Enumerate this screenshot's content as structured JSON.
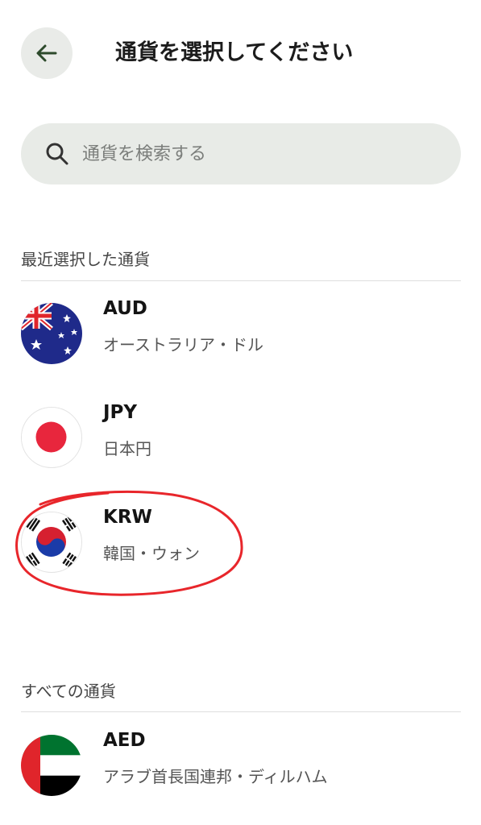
{
  "header": {
    "title": "通貨を選択してください"
  },
  "search": {
    "placeholder": "通貨を検索する"
  },
  "recent": {
    "title": "最近選択した通貨",
    "items": [
      {
        "code": "AUD",
        "name": "オーストラリア・ドル",
        "flag": "australia-flag-icon"
      },
      {
        "code": "JPY",
        "name": "日本円",
        "flag": "japan-flag-icon"
      },
      {
        "code": "KRW",
        "name": "韓国・ウォン",
        "flag": "south-korea-flag-icon"
      }
    ]
  },
  "all": {
    "title": "すべての通貨",
    "items": [
      {
        "code": "AED",
        "name": "アラブ首長国連邦・ディルハム",
        "flag": "uae-flag-icon"
      }
    ]
  },
  "colors": {
    "accent": "#2f5d2f",
    "annotation": "#e8262b"
  }
}
